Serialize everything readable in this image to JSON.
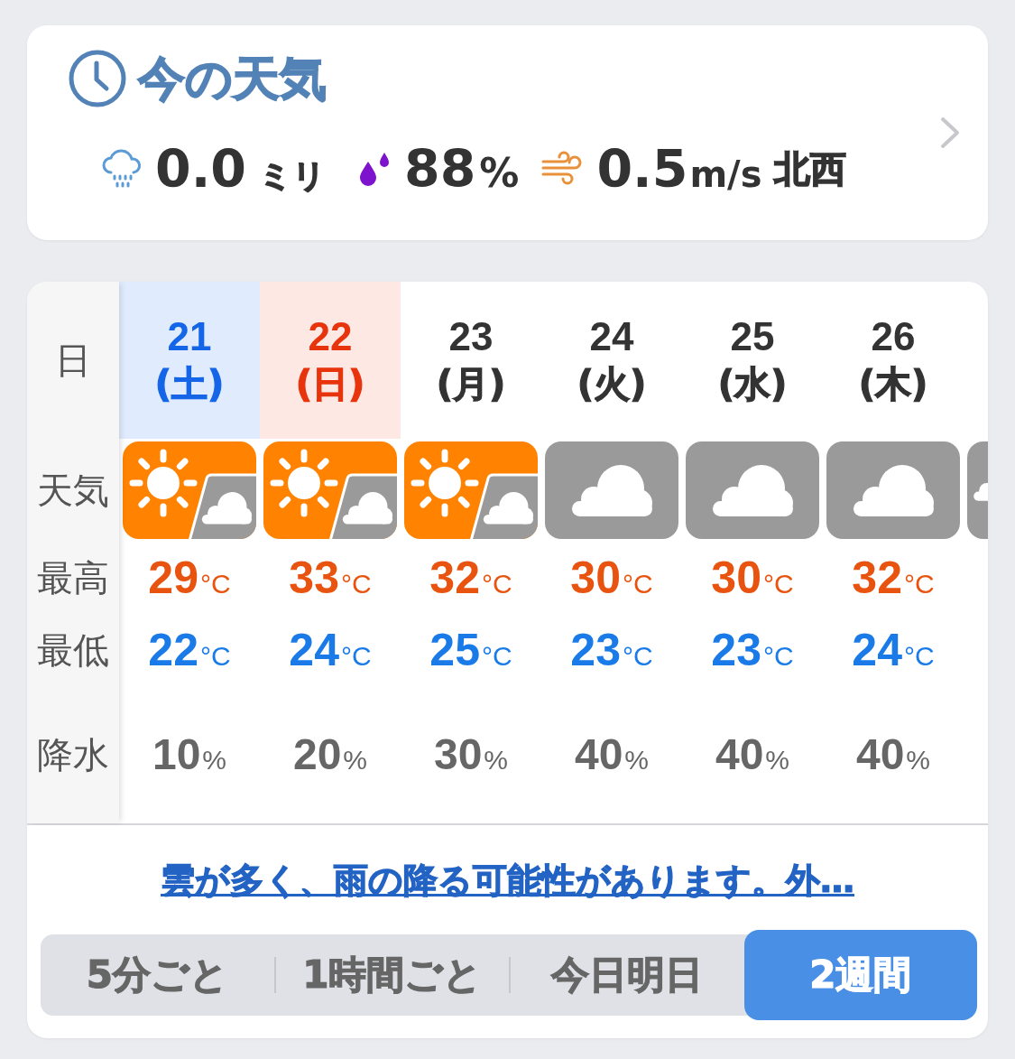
{
  "current": {
    "title": "今の天気",
    "rain": {
      "value": "0.0",
      "unit": "ミリ"
    },
    "humidity": {
      "value": "88",
      "unit": "%"
    },
    "wind": {
      "value": "0.5",
      "unit": "m/s",
      "direction": "北西"
    }
  },
  "forecast": {
    "row_labels": [
      "日",
      "天気",
      "最高",
      "最低",
      "降水"
    ],
    "days": [
      {
        "date": "21",
        "weekday": "(土)",
        "kind": "saturday",
        "weather": {
          "kind": "sunny_cloudy"
        },
        "high": {
          "value": "29",
          "unit": "°C"
        },
        "low": {
          "value": "22",
          "unit": "°C"
        },
        "precip": {
          "value": "10",
          "unit": "%"
        }
      },
      {
        "date": "22",
        "weekday": "(日)",
        "kind": "sunday",
        "weather": {
          "kind": "sunny_cloudy"
        },
        "high": {
          "value": "33",
          "unit": "°C"
        },
        "low": {
          "value": "24",
          "unit": "°C"
        },
        "precip": {
          "value": "20",
          "unit": "%"
        }
      },
      {
        "date": "23",
        "weekday": "(月)",
        "kind": "weekday",
        "weather": {
          "kind": "sunny_cloudy"
        },
        "high": {
          "value": "32",
          "unit": "°C"
        },
        "low": {
          "value": "25",
          "unit": "°C"
        },
        "precip": {
          "value": "30",
          "unit": "%"
        }
      },
      {
        "date": "24",
        "weekday": "(火)",
        "kind": "weekday",
        "weather": {
          "kind": "cloudy"
        },
        "high": {
          "value": "30",
          "unit": "°C"
        },
        "low": {
          "value": "23",
          "unit": "°C"
        },
        "precip": {
          "value": "40",
          "unit": "%"
        }
      },
      {
        "date": "25",
        "weekday": "(水)",
        "kind": "weekday",
        "weather": {
          "kind": "cloudy"
        },
        "high": {
          "value": "30",
          "unit": "°C"
        },
        "low": {
          "value": "23",
          "unit": "°C"
        },
        "precip": {
          "value": "40",
          "unit": "%"
        }
      },
      {
        "date": "26",
        "weekday": "(木)",
        "kind": "weekday",
        "weather": {
          "kind": "cloudy"
        },
        "high": {
          "value": "32",
          "unit": "°C"
        },
        "low": {
          "value": "24",
          "unit": "°C"
        },
        "precip": {
          "value": "40",
          "unit": "%"
        }
      },
      {
        "weather": {
          "kind": "cloudy_mixed"
        }
      }
    ],
    "summary_link": "雲が多く、雨の降る可能性があります。外…"
  },
  "tabs": [
    {
      "label": "5分ごと",
      "selected": false
    },
    {
      "label": "1時間ごと",
      "selected": false
    },
    {
      "label": "今日明日",
      "selected": false
    },
    {
      "label": "2週間",
      "selected": true
    }
  ]
}
